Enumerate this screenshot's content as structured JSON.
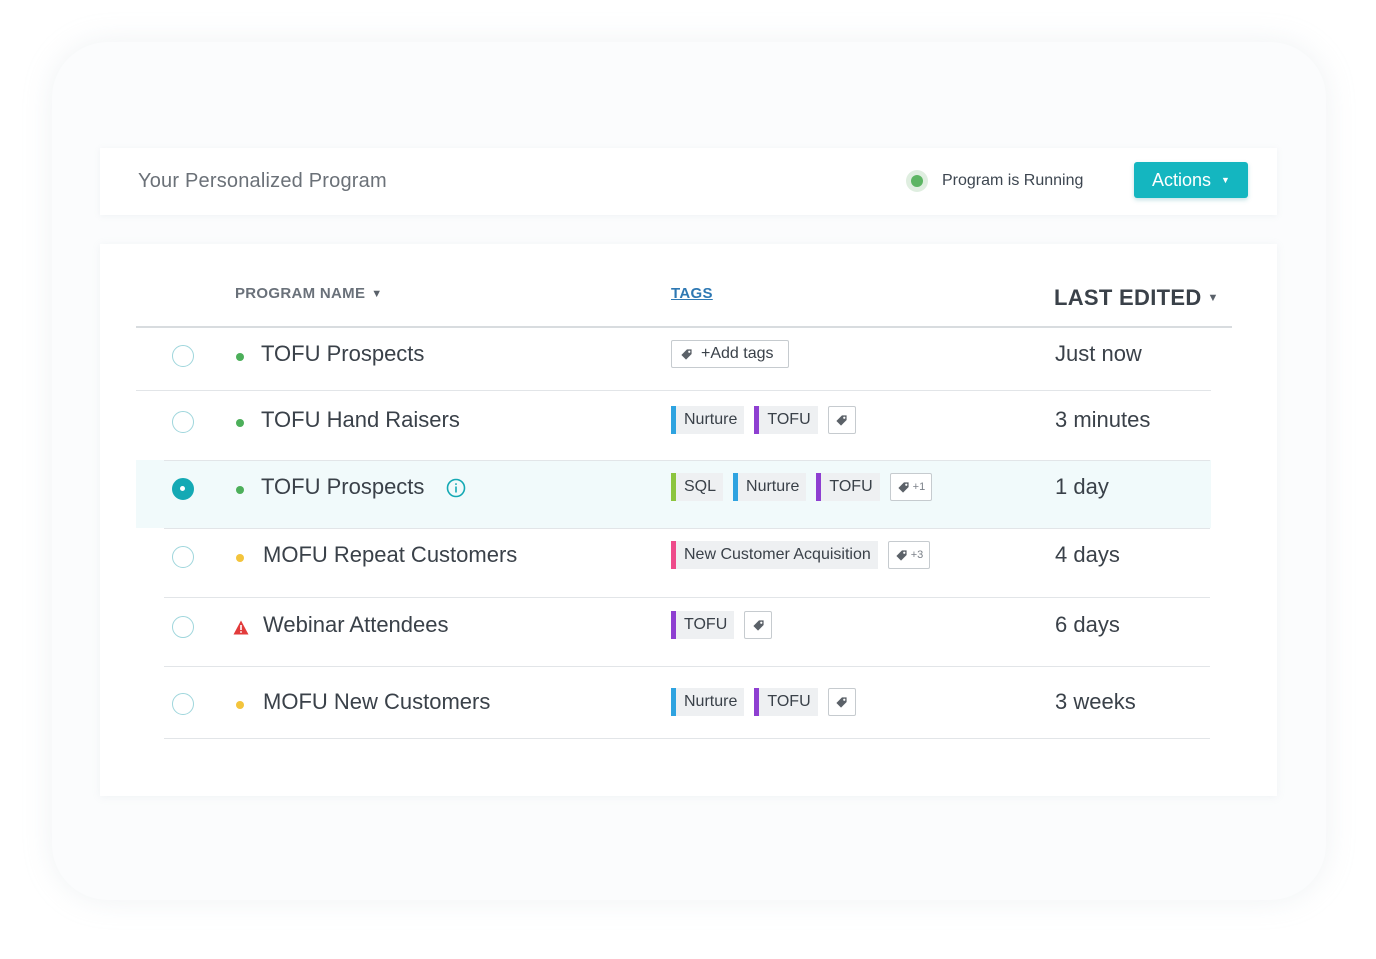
{
  "header": {
    "title": "Your Personalized Program",
    "status_text": "Program is Running",
    "actions_label": "Actions"
  },
  "table": {
    "columns": {
      "name": "PROGRAM NAME",
      "tags": "TAGS",
      "edited": "LAST EDITED"
    },
    "add_tags_label": "+Add tags",
    "rows": [
      {
        "name": "TOFU Prospects",
        "status": "green",
        "selected": false,
        "tags": [],
        "extra_tags": "",
        "edited": "Just now"
      },
      {
        "name": "TOFU Hand Raisers",
        "status": "green",
        "selected": false,
        "tags": [
          {
            "label": "Nurture",
            "color": "#2ea3e0"
          },
          {
            "label": "TOFU",
            "color": "#8e3fd1"
          }
        ],
        "extra_tags": "",
        "edited": "3 minutes"
      },
      {
        "name": "TOFU Prospects",
        "status": "green",
        "selected": true,
        "tags": [
          {
            "label": "SQL",
            "color": "#8cc53e"
          },
          {
            "label": "Nurture",
            "color": "#2ea3e0"
          },
          {
            "label": "TOFU",
            "color": "#8e3fd1"
          }
        ],
        "extra_tags": "+1",
        "edited": "1 day"
      },
      {
        "name": "MOFU Repeat Customers",
        "status": "yellow",
        "selected": false,
        "tags": [
          {
            "label": "New Customer Acquisition",
            "color": "#ee4b8a"
          }
        ],
        "extra_tags": "+3",
        "edited": "4 days"
      },
      {
        "name": "Webinar Attendees",
        "status": "warning",
        "selected": false,
        "tags": [
          {
            "label": "TOFU",
            "color": "#8e3fd1"
          }
        ],
        "extra_tags": "",
        "edited": "6 days"
      },
      {
        "name": "MOFU New Customers",
        "status": "yellow",
        "selected": false,
        "tags": [
          {
            "label": "Nurture",
            "color": "#2ea3e0"
          },
          {
            "label": "TOFU",
            "color": "#8e3fd1"
          }
        ],
        "extra_tags": "",
        "edited": "3 weeks"
      }
    ]
  },
  "colors": {
    "accent": "#14b6c0",
    "running": "#5cb563",
    "warning": "#e23b3b"
  }
}
